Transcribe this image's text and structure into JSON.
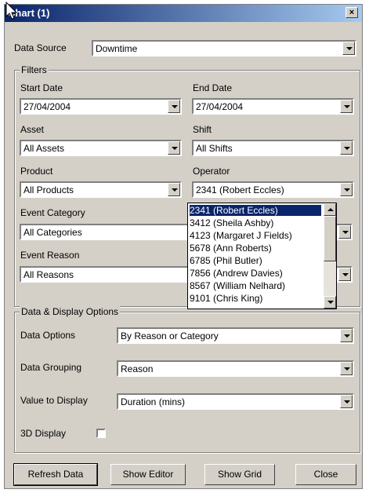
{
  "window": {
    "title": "Chart (1)"
  },
  "data_source": {
    "label": "Data Source",
    "value": "Downtime"
  },
  "filters": {
    "title": "Filters",
    "start_date": {
      "label": "Start Date",
      "value": "27/04/2004"
    },
    "end_date": {
      "label": "End Date",
      "value": "27/04/2004"
    },
    "asset": {
      "label": "Asset",
      "value": "All Assets"
    },
    "shift": {
      "label": "Shift",
      "value": "All Shifts"
    },
    "product": {
      "label": "Product",
      "value": "All Products"
    },
    "operator": {
      "label": "Operator",
      "value": "2341 (Robert Eccles)",
      "options": [
        "2341 (Robert Eccles)",
        "3412 (Sheila Ashby)",
        "4123 (Margaret J Fields)",
        "5678 (Ann Roberts)",
        "6785 (Phil Butler)",
        "7856 (Andrew Davies)",
        "8567 (William Nelhard)",
        "9101 (Chris King)"
      ]
    },
    "event_category": {
      "label": "Event Category",
      "value": "All Categories"
    },
    "event_reason": {
      "label": "Event Reason",
      "value": "All Reasons"
    }
  },
  "display_options": {
    "title": "Data & Display Options",
    "data_options": {
      "label": "Data Options",
      "value": "By Reason or Category"
    },
    "data_grouping": {
      "label": "Data Grouping",
      "value": "Reason"
    },
    "value_to_display": {
      "label": "Value to Display",
      "value": "Duration (mins)"
    },
    "display_3d": {
      "label": "3D Display",
      "checked": false
    }
  },
  "buttons": {
    "refresh": "Refresh Data",
    "show_editor": "Show Editor",
    "show_grid": "Show Grid",
    "close": "Close"
  }
}
